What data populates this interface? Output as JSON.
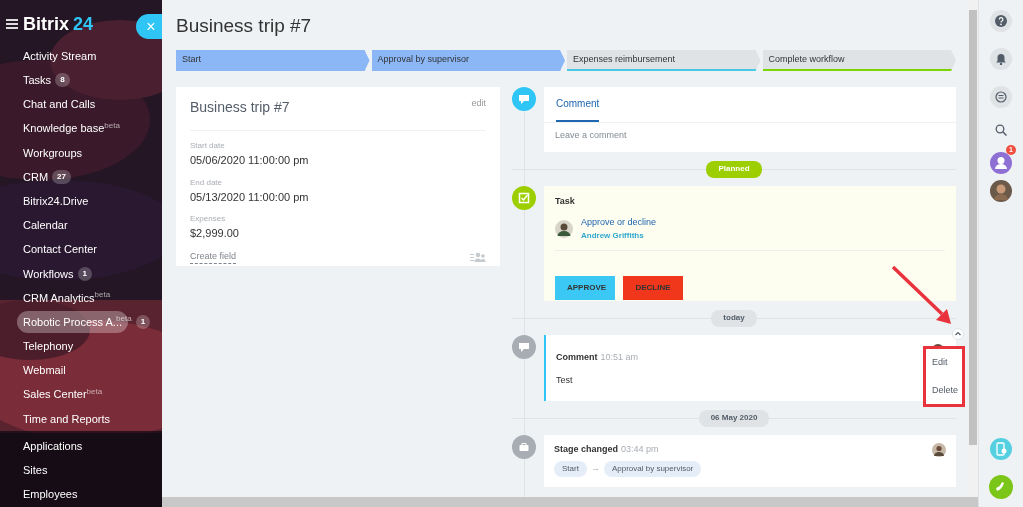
{
  "sidebar": {
    "logo": {
      "name": "Bitrix",
      "number": "24"
    },
    "close_button": "×",
    "items": [
      {
        "label": "Activity Stream",
        "selected": false
      },
      {
        "label": "Tasks",
        "counter": "8",
        "selected": false
      },
      {
        "label": "Chat and Calls",
        "selected": false
      },
      {
        "label": "Knowledge base",
        "tag": "beta",
        "selected": false
      },
      {
        "label": "Workgroups",
        "selected": false
      },
      {
        "label": "CRM",
        "counter": "27",
        "selected": false
      },
      {
        "label": "Bitrix24.Drive",
        "selected": false
      },
      {
        "label": "Calendar",
        "selected": false
      },
      {
        "label": "Contact Center",
        "selected": false
      },
      {
        "label": "Workflows",
        "counter": "1",
        "selected": false
      },
      {
        "label": "CRM Analytics",
        "tag": "beta",
        "selected": false
      },
      {
        "label": "Robotic Process A...",
        "tag": "beta",
        "counter": "1",
        "selected": true
      },
      {
        "label": "Telephony",
        "selected": false
      },
      {
        "label": "Webmail",
        "selected": false
      },
      {
        "label": "Sales Center",
        "tag": "beta",
        "selected": false
      },
      {
        "label": "Time and Reports",
        "selected": false
      }
    ],
    "footer_items": [
      {
        "label": "Applications",
        "selected": false
      },
      {
        "label": "Sites",
        "selected": false
      },
      {
        "label": "Employees",
        "selected": false
      }
    ]
  },
  "page": {
    "title": "Business trip #7"
  },
  "stages": [
    {
      "label": "Start",
      "passed": true,
      "color": "#8bb7f7"
    },
    {
      "label": "Approval by supervisor",
      "passed": true,
      "color": "#8bb7f7"
    },
    {
      "label": "Expenses reimbursement",
      "passed": false,
      "color": "#47c9e5"
    },
    {
      "label": "Complete workflow",
      "passed": false,
      "color": "#7bd500"
    }
  ],
  "details": {
    "title": "Business trip #7",
    "edit_link": "edit",
    "fields": [
      {
        "label": "Start date",
        "value": "05/06/2020 11:00:00 pm"
      },
      {
        "label": "End date",
        "value": "05/13/2020 11:00:00 pm"
      },
      {
        "label": "Expenses",
        "value": "$2,999.00"
      }
    ],
    "create_field": "Create field"
  },
  "composer": {
    "tabs": [
      {
        "label": "Comment",
        "selected": true
      }
    ],
    "placeholder": "Leave a comment"
  },
  "timeline": [
    {
      "kind": "divider",
      "label": "Planned",
      "color": "#9dcf00"
    },
    {
      "kind": "task",
      "title": "Task",
      "subject": "Approve or decline",
      "person": "Andrew Griffiths",
      "buttons": [
        {
          "label": "APPROVE",
          "color": "#3bc8f5"
        },
        {
          "label": "DECLINE",
          "color": "#f0371b"
        }
      ]
    },
    {
      "kind": "divider",
      "label": "today",
      "color": "#dfe3e6"
    },
    {
      "kind": "comment",
      "title": "Comment",
      "time": "10:51 am",
      "text": "Test",
      "menu": {
        "items": [
          "Edit",
          "Delete"
        ]
      }
    },
    {
      "kind": "divider",
      "label": "06 May 2020",
      "color": "#dfe3e6"
    },
    {
      "kind": "stage",
      "title": "Stage changed",
      "time": "03:44 pm",
      "from": "Start",
      "to": "Approval by supervisor",
      "arrow": "→"
    }
  ],
  "right_bar": {
    "badge": "1"
  }
}
